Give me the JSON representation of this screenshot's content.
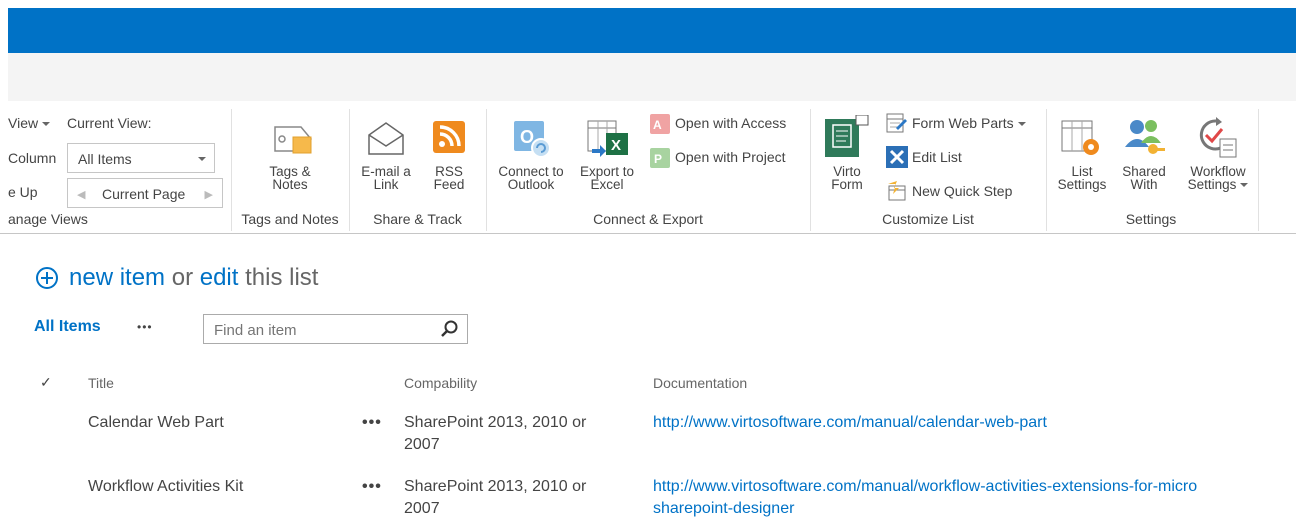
{
  "ribbon": {
    "manage_views": {
      "row1_left": "View",
      "current_view_label": "Current View:",
      "row2_left": "Column",
      "current_view_value": "All Items",
      "row3_left": "e Up",
      "current_page": "Current Page",
      "group_label": "anage Views"
    },
    "tags": {
      "button": "Tags &\nNotes",
      "group_label": "Tags and Notes"
    },
    "share": {
      "email": "E-mail a\nLink",
      "rss": "RSS\nFeed",
      "group_label": "Share & Track"
    },
    "connect": {
      "outlook": "Connect to\nOutlook",
      "excel": "Export to\nExcel",
      "access": "Open with Access",
      "project": "Open with Project",
      "group_label": "Connect & Export"
    },
    "customize": {
      "virto": "Virto\nForm",
      "form_web_parts": "Form Web Parts",
      "edit_list": "Edit List",
      "new_quick_step": "New Quick Step",
      "group_label": "Customize List"
    },
    "settings": {
      "list_settings": "List\nSettings",
      "shared_with": "Shared\nWith",
      "workflow_settings": "Workflow\nSettings",
      "group_label": "Settings"
    }
  },
  "content": {
    "new_item": "new item",
    "or": "or",
    "edit": "edit",
    "this_list": "this list",
    "view_name": "All Items",
    "more": "•••",
    "search_placeholder": "Find an item",
    "columns": [
      "Title",
      "Compability",
      "Documentation"
    ],
    "rows": [
      {
        "title": "Calendar Web Part",
        "compat": "SharePoint 2013, 2010 or\n2007",
        "doc": "http://www.virtosoftware.com/manual/calendar-web-part"
      },
      {
        "title": "Workflow Activities Kit",
        "compat": "SharePoint 2013, 2010 or\n2007",
        "doc": "http://www.virtosoftware.com/manual/workflow-activities-extensions-for-micro\nsharepoint-designer"
      }
    ]
  },
  "colors": {
    "suite_bar": "#0072c6",
    "link": "#0072c6"
  }
}
